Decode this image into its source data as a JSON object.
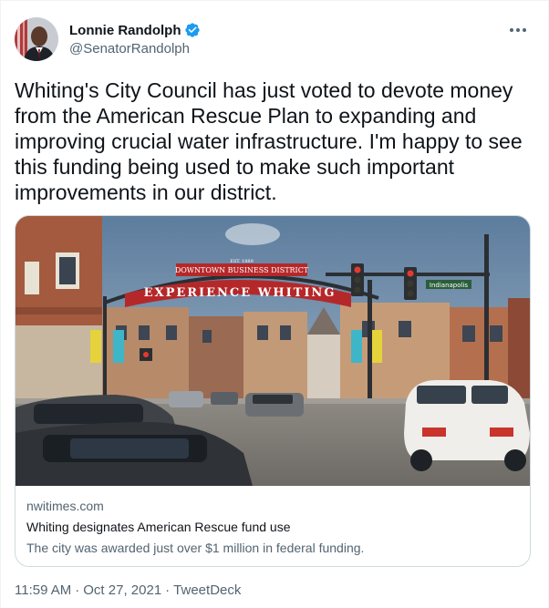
{
  "author": {
    "display_name": "Lonnie Randolph",
    "handle": "@SenatorRandolph",
    "verified": true
  },
  "tweet": {
    "text": "Whiting's City Council has just voted to devote money from the American Rescue Plan to expanding and improving crucial water infrastructure. I'm happy to see this funding being used to make such important improvements in our district."
  },
  "card": {
    "image": {
      "sign_main": "EXPERIENCE WHITING",
      "sign_top": "DOWNTOWN BUSINESS DISTRICT",
      "sign_est": "EST. 1889",
      "street_sign": "Indianapolis"
    },
    "domain": "nwitimes.com",
    "title": "Whiting designates American Rescue fund use",
    "description": "The city was awarded just over $1 million in federal funding."
  },
  "meta": {
    "time": "11:59 AM",
    "separator1": "·",
    "date": "Oct 27, 2021",
    "separator2": "·",
    "source": "TweetDeck"
  },
  "colors": {
    "text_primary": "#0f1419",
    "text_secondary": "#536471",
    "verified_blue": "#1d9bf0",
    "border": "#cfd9de"
  },
  "icons": {
    "verified": "verified-badge-icon",
    "more": "more-options-icon"
  }
}
